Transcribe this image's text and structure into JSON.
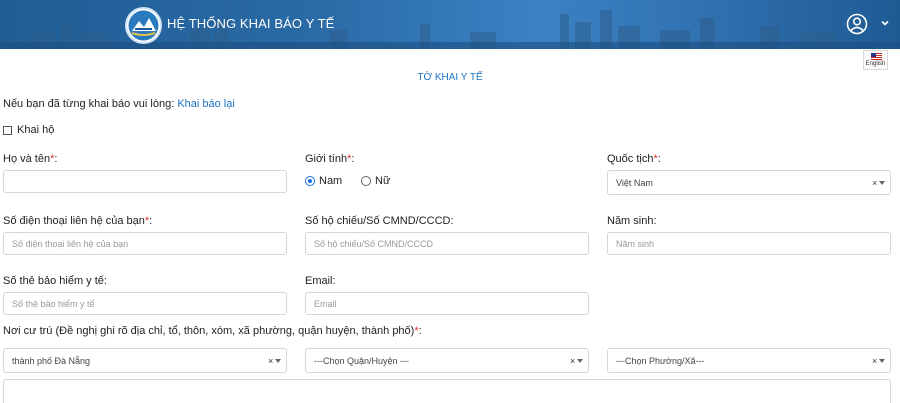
{
  "header": {
    "title": "HỆ THỐNG KHAI BÁO Y TẾ",
    "language": "English",
    "colors": {
      "bar": "#2a6aa6",
      "accent": "#1a73c4",
      "required": "#d9302c"
    }
  },
  "form": {
    "title": "TỜ KHAI Y TẾ",
    "notice_text": "Nếu bạn đã từng khai báo vui lòng: ",
    "notice_link": "Khai báo lại",
    "household_label": "Khai hộ",
    "fullname": {
      "label": "Họ và tên",
      "required": "*",
      "suffix": ":",
      "value": ""
    },
    "gender": {
      "label": "Giới tính",
      "required": "*",
      "suffix": ":",
      "options": [
        "Nam",
        "Nữ"
      ],
      "selected": "Nam"
    },
    "nationality": {
      "label": "Quốc tịch",
      "required": "*",
      "suffix": ":",
      "value": "Việt Nam"
    },
    "phone": {
      "label": "Số điện thoại liên hệ của bạn",
      "required": "*",
      "suffix": ":",
      "placeholder": "Số điện thoại liên hệ của bạn"
    },
    "passport": {
      "label": "Số hộ chiếu/Số CMND/CCCD:",
      "placeholder": "Số hộ chiếu/Số CMND/CCCD"
    },
    "birth_year": {
      "label": "Năm sinh:",
      "placeholder": "Năm sinh"
    },
    "insurance": {
      "label": "Số thẻ bảo hiểm y tế:",
      "placeholder": "Số thẻ bảo hiểm y tế"
    },
    "email": {
      "label": "Email:",
      "placeholder": "Email"
    },
    "residence": {
      "label": "Nơi cư trú (Đề nghị ghi rõ địa chỉ, tổ, thôn, xóm, xã phường, quận huyện, thành phố)",
      "required": "*",
      "suffix": ":",
      "city": "thành phố Đà Nẵng",
      "district": "---Chọn Quận/Huyện ---",
      "ward": "---Chọn Phường/Xã---"
    }
  },
  "icons": [
    "logo-emblem",
    "user-circle-icon",
    "chevron-down-icon",
    "us-flag-icon",
    "clear-icon",
    "dropdown-arrow-icon"
  ]
}
